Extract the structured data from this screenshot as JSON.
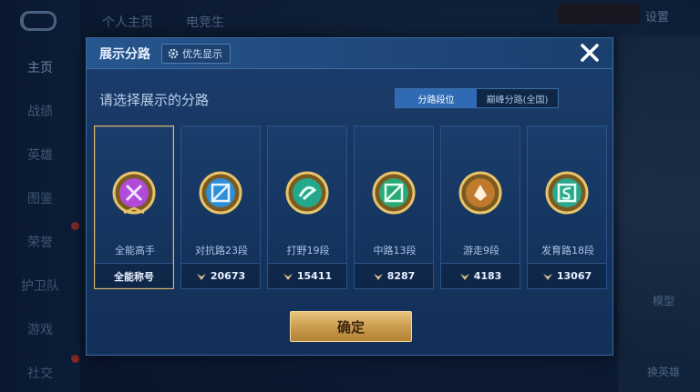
{
  "background": {
    "nav": [
      {
        "label": "主页",
        "active": true
      },
      {
        "label": "战绩",
        "active": false
      },
      {
        "label": "英雄",
        "active": false
      },
      {
        "label": "图鉴",
        "active": false
      },
      {
        "label": "荣誉",
        "active": false
      },
      {
        "label": "护卫队",
        "active": false
      },
      {
        "label": "游戏",
        "active": false
      },
      {
        "label": "社交",
        "active": false
      }
    ],
    "top_tabs": [
      "个人主页",
      "电竞生"
    ],
    "settings_label": "设置",
    "right_buttons": [
      "模型",
      "换英雄"
    ]
  },
  "modal": {
    "title": "展示分路",
    "priority_label": "优先显示",
    "subtitle": "请选择展示的分路",
    "toggle": {
      "options": [
        "分路段位",
        "巅峰分路(全国)"
      ],
      "selected": 0
    },
    "cards": [
      {
        "label": "全能高手",
        "footer": "全能称号",
        "footer_has_icon": false,
        "emblem": "all-round-emblem-icon",
        "color": "#b04ad8",
        "selected": true
      },
      {
        "label": "对抗路23段",
        "footer": "20673",
        "footer_has_icon": true,
        "emblem": "clash-lane-emblem-icon",
        "color": "#2e8fd8",
        "selected": false
      },
      {
        "label": "打野19段",
        "footer": "15411",
        "footer_has_icon": true,
        "emblem": "jungle-emblem-icon",
        "color": "#23a88c",
        "selected": false
      },
      {
        "label": "中路13段",
        "footer": "8287",
        "footer_has_icon": true,
        "emblem": "mid-lane-emblem-icon",
        "color": "#2aa876",
        "selected": false
      },
      {
        "label": "游走9段",
        "footer": "4183",
        "footer_has_icon": true,
        "emblem": "roam-emblem-icon",
        "color": "#c07a2e",
        "selected": false
      },
      {
        "label": "发育路18段",
        "footer": "13067",
        "footer_has_icon": true,
        "emblem": "farm-lane-emblem-icon",
        "color": "#2aa88c",
        "selected": false
      }
    ],
    "confirm_label": "确定"
  },
  "colors": {
    "accent_gold": "#e0b86a",
    "toggle_active": "#2f6bb4"
  }
}
